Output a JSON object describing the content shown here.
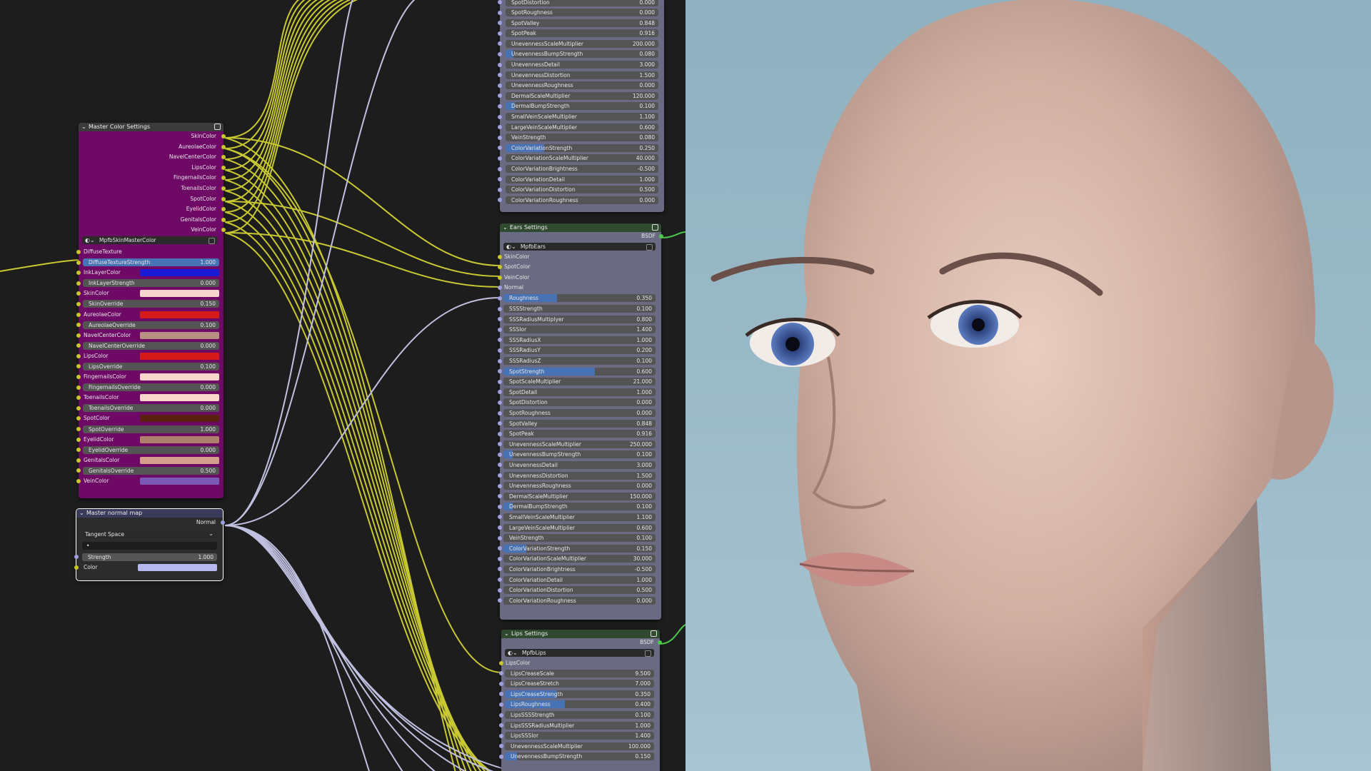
{
  "master_color": {
    "title": "Master Color Settings",
    "outputs": [
      "SkinColor",
      "AureolaeColor",
      "NavelCenterColor",
      "LipsColor",
      "FingernailsColor",
      "ToenailsColor",
      "SpotColor",
      "EyelidColor",
      "GenitalsColor",
      "VeinColor"
    ],
    "group_name": "MpfbSkinMasterColor",
    "rows": [
      {
        "type": "label",
        "label": "DiffuseTexture"
      },
      {
        "type": "slider",
        "label": "DiffuseTextureStrength",
        "value": "1.000",
        "fill": 1.0
      },
      {
        "type": "color",
        "label": "InkLayerColor",
        "color": "#1a1ad4"
      },
      {
        "type": "slider",
        "label": "InkLayerStrength",
        "value": "0.000",
        "fill": 0
      },
      {
        "type": "color",
        "label": "SkinColor",
        "color": "#f4d4cc"
      },
      {
        "type": "slider",
        "label": "SkinOverride",
        "value": "0.150",
        "fill": 0
      },
      {
        "type": "color",
        "label": "AureolaeColor",
        "color": "#d41a1a"
      },
      {
        "type": "slider",
        "label": "AureolaeOverride",
        "value": "0.100",
        "fill": 0
      },
      {
        "type": "color",
        "label": "NavelCenterColor",
        "color": "#b88f80"
      },
      {
        "type": "slider",
        "label": "NavelCenterOverride",
        "value": "0.000",
        "fill": 0
      },
      {
        "type": "color",
        "label": "LipsColor",
        "color": "#d41a1a"
      },
      {
        "type": "slider",
        "label": "LipsOverride",
        "value": "0.100",
        "fill": 0
      },
      {
        "type": "color",
        "label": "FingernailsColor",
        "color": "#f8d6cc"
      },
      {
        "type": "slider",
        "label": "FingernailsOverride",
        "value": "0.000",
        "fill": 0
      },
      {
        "type": "color",
        "label": "ToenailsColor",
        "color": "#f8d6cc"
      },
      {
        "type": "slider",
        "label": "ToenailsOverride",
        "value": "0.000",
        "fill": 0
      },
      {
        "type": "color",
        "label": "SpotColor",
        "color": "#5a2010"
      },
      {
        "type": "slider",
        "label": "SpotOverride",
        "value": "1.000",
        "fill": 0
      },
      {
        "type": "color",
        "label": "EyelidColor",
        "color": "#b0806e"
      },
      {
        "type": "slider",
        "label": "EyelidOverride",
        "value": "0.000",
        "fill": 0
      },
      {
        "type": "color",
        "label": "GenitalsColor",
        "color": "#d4a08e"
      },
      {
        "type": "slider",
        "label": "GenitalsOverride",
        "value": "0.500",
        "fill": 0
      },
      {
        "type": "color",
        "label": "VeinColor",
        "color": "#7a5ab4"
      }
    ]
  },
  "normal_map": {
    "title": "Master normal map",
    "output": "Normal",
    "space": "Tangent Space",
    "uv": "•",
    "strength_label": "Strength",
    "strength_value": "1.000",
    "color_label": "Color",
    "color": "#b8b8f0"
  },
  "top_node": {
    "rows": [
      {
        "label": "SpotDistortion",
        "value": "0.000",
        "fill": 0
      },
      {
        "label": "SpotRoughness",
        "value": "0.000",
        "fill": 0
      },
      {
        "label": "SpotValley",
        "value": "0.848",
        "fill": 0
      },
      {
        "label": "SpotPeak",
        "value": "0.916",
        "fill": 0
      },
      {
        "label": "UnevennessScaleMultiplier",
        "value": "200.000",
        "fill": 0
      },
      {
        "label": "UnevennessBumpStrength",
        "value": "0.080",
        "fill": 0.05
      },
      {
        "label": "UnevennessDetail",
        "value": "3.000",
        "fill": 0
      },
      {
        "label": "UnevennessDistortion",
        "value": "1.500",
        "fill": 0
      },
      {
        "label": "UnevennessRoughness",
        "value": "0.000",
        "fill": 0
      },
      {
        "label": "DermalScaleMultiplier",
        "value": "120.000",
        "fill": 0
      },
      {
        "label": "DermalBumpStrength",
        "value": "0.100",
        "fill": 0.06
      },
      {
        "label": "SmallVeinScaleMultiplier",
        "value": "1.100",
        "fill": 0
      },
      {
        "label": "LargeVeinScaleMultiplier",
        "value": "0.600",
        "fill": 0
      },
      {
        "label": "VeinStrength",
        "value": "0.080",
        "fill": 0
      },
      {
        "label": "ColorVariationStrength",
        "value": "0.250",
        "fill": 0.25
      },
      {
        "label": "ColorVariationScaleMultiplier",
        "value": "40.000",
        "fill": 0
      },
      {
        "label": "ColorVariationBrightness",
        "value": "-0.500",
        "fill": 0
      },
      {
        "label": "ColorVariationDetail",
        "value": "1.000",
        "fill": 0
      },
      {
        "label": "ColorVariationDistortion",
        "value": "0.500",
        "fill": 0
      },
      {
        "label": "ColorVariationRoughness",
        "value": "0.000",
        "fill": 0
      }
    ]
  },
  "ears": {
    "title": "Ears Settings",
    "output": "BSDF",
    "group_name": "MpfbEars",
    "inputs": [
      "SkinColor",
      "SpotColor",
      "VeinColor",
      "Normal"
    ],
    "rows": [
      {
        "label": "Roughness",
        "value": "0.350",
        "fill": 0.35
      },
      {
        "label": "SSSStrength",
        "value": "0.100",
        "fill": 0
      },
      {
        "label": "SSSRadiusMultiplyer",
        "value": "0.800",
        "fill": 0
      },
      {
        "label": "SSSIor",
        "value": "1.400",
        "fill": 0
      },
      {
        "label": "SSSRadiusX",
        "value": "1.000",
        "fill": 0
      },
      {
        "label": "SSSRadiusY",
        "value": "0.200",
        "fill": 0
      },
      {
        "label": "SSSRadiusZ",
        "value": "0.100",
        "fill": 0
      },
      {
        "label": "SpotStrength",
        "value": "0.600",
        "fill": 0.6
      },
      {
        "label": "SpotScaleMultiplier",
        "value": "21.000",
        "fill": 0
      },
      {
        "label": "SpotDetail",
        "value": "1.000",
        "fill": 0
      },
      {
        "label": "SpotDistortion",
        "value": "0.000",
        "fill": 0
      },
      {
        "label": "SpotRoughness",
        "value": "0.000",
        "fill": 0
      },
      {
        "label": "SpotValley",
        "value": "0.848",
        "fill": 0
      },
      {
        "label": "SpotPeak",
        "value": "0.916",
        "fill": 0
      },
      {
        "label": "UnevennessScaleMultiplier",
        "value": "250.000",
        "fill": 0
      },
      {
        "label": "UnevennessBumpStrength",
        "value": "0.100",
        "fill": 0.06
      },
      {
        "label": "UnevennessDetail",
        "value": "3.000",
        "fill": 0
      },
      {
        "label": "UnevennessDistortion",
        "value": "1.500",
        "fill": 0
      },
      {
        "label": "UnevennessRoughness",
        "value": "0.000",
        "fill": 0
      },
      {
        "label": "DermalScaleMultiplier",
        "value": "150.000",
        "fill": 0
      },
      {
        "label": "DermalBumpStrength",
        "value": "0.100",
        "fill": 0.06
      },
      {
        "label": "SmallVeinScaleMultiplier",
        "value": "1.100",
        "fill": 0
      },
      {
        "label": "LargeVeinScaleMultiplier",
        "value": "0.600",
        "fill": 0
      },
      {
        "label": "VeinStrength",
        "value": "0.100",
        "fill": 0
      },
      {
        "label": "ColorVariationStrength",
        "value": "0.150",
        "fill": 0.15
      },
      {
        "label": "ColorVariationScaleMultiplier",
        "value": "30.000",
        "fill": 0
      },
      {
        "label": "ColorVariationBrightness",
        "value": "-0.500",
        "fill": 0
      },
      {
        "label": "ColorVariationDetail",
        "value": "1.000",
        "fill": 0
      },
      {
        "label": "ColorVariationDistortion",
        "value": "0.500",
        "fill": 0
      },
      {
        "label": "ColorVariationRoughness",
        "value": "0.000",
        "fill": 0
      }
    ]
  },
  "lips": {
    "title": "Lips Settings",
    "output": "BSDF",
    "group_name": "MpfbLips",
    "inputs": [
      "LipsColor"
    ],
    "rows": [
      {
        "label": "LipsCreaseScale",
        "value": "9.500",
        "fill": 0
      },
      {
        "label": "LipsCreaseStretch",
        "value": "7.000",
        "fill": 0
      },
      {
        "label": "LipsCreaseStrength",
        "value": "0.350",
        "fill": 0.35
      },
      {
        "label": "LipsRoughness",
        "value": "0.400",
        "fill": 0.4
      },
      {
        "label": "LipsSSSStrength",
        "value": "0.100",
        "fill": 0
      },
      {
        "label": "LipsSSSRadiusMultiplier",
        "value": "1.000",
        "fill": 0
      },
      {
        "label": "LipsSSSIor",
        "value": "1.400",
        "fill": 0
      },
      {
        "label": "UnevennessScaleMultiplier",
        "value": "100.000",
        "fill": 0
      },
      {
        "label": "UnevennessBumpStrength",
        "value": "0.150",
        "fill": 0.08
      }
    ]
  },
  "colors": {
    "master_body": "#6e0a66",
    "master_header": "#3b3b3b",
    "group_body": "#6a6a82",
    "group_header": "#2f4a2f",
    "wire_yellow": "#c8c832",
    "wire_lavender": "#c0c0e0",
    "viewport_bg": "#9dbccb"
  }
}
